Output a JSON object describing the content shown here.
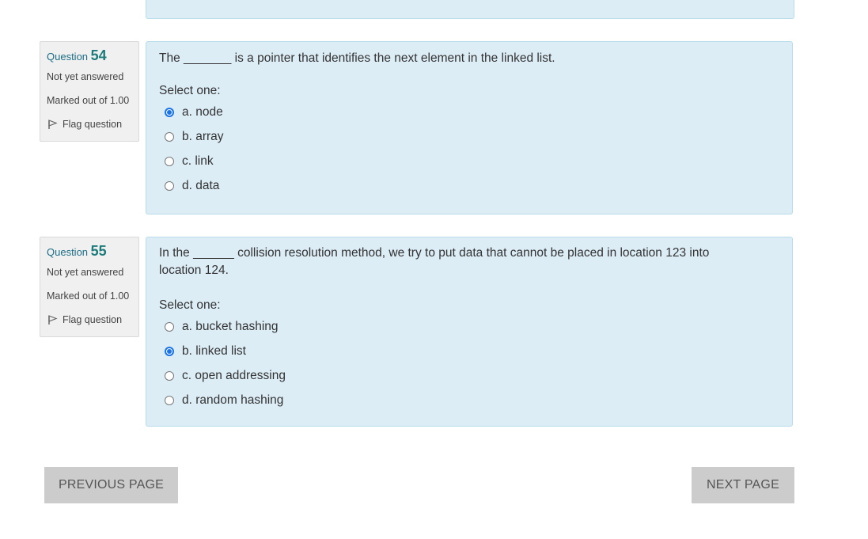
{
  "questions": [
    {
      "label": "Question",
      "number": "54",
      "state": "Not yet answered",
      "grade": "Marked out of 1.00",
      "flag": "Flag question",
      "text": "The _______ is a pointer that identifies the next element in the linked list.",
      "select_label": "Select one:",
      "options": [
        {
          "label": "a. node",
          "checked": true
        },
        {
          "label": "b. array",
          "checked": false
        },
        {
          "label": "c. link",
          "checked": false
        },
        {
          "label": "d. data",
          "checked": false
        }
      ]
    },
    {
      "label": "Question",
      "number": "55",
      "state": "Not yet answered",
      "grade": "Marked out of 1.00",
      "flag": "Flag question",
      "text": "In the ______ collision resolution method, we try to put data that cannot be placed in location 123 into location 124.",
      "select_label": "Select one:",
      "options": [
        {
          "label": "a. bucket hashing",
          "checked": false
        },
        {
          "label": "b. linked list",
          "checked": true
        },
        {
          "label": "c. open addressing",
          "checked": false
        },
        {
          "label": "d. random hashing",
          "checked": false
        }
      ]
    }
  ],
  "nav": {
    "previous": "PREVIOUS PAGE",
    "next": "NEXT PAGE"
  },
  "colors": {
    "panel_bg": "#dcedf6",
    "radio_accent": "#1a73e8",
    "button_bg": "#cccccc"
  }
}
